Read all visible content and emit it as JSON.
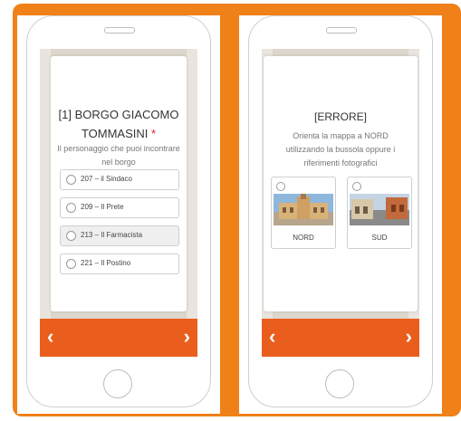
{
  "left_screen": {
    "title": "[1] BORGO GIACOMO TOMMASINI",
    "required_mark": "*",
    "subtitle": "Il personaggio che puoi incontrare nel borgo",
    "options": [
      {
        "label": "207 – il Sindaco"
      },
      {
        "label": "209 – Il Prete"
      },
      {
        "label": "213 – Il Farmacista",
        "highlighted": true
      },
      {
        "label": "221 – Il Postino"
      }
    ]
  },
  "right_screen": {
    "title": "[ERRORE]",
    "subtitle": "Orienta la mappa a NORD utilizzando la bussola oppure i riferimenti fotografici",
    "choices": [
      {
        "label": "NORD"
      },
      {
        "label": "SUD"
      }
    ]
  },
  "nav": {
    "prev_icon": "chevron-left-icon",
    "next_icon": "chevron-right-icon",
    "prev_glyph": "‹",
    "next_glyph": "›"
  },
  "colors": {
    "frame": "#f08018",
    "nav_bar": "#ea5e1d",
    "required": "#e02020"
  }
}
